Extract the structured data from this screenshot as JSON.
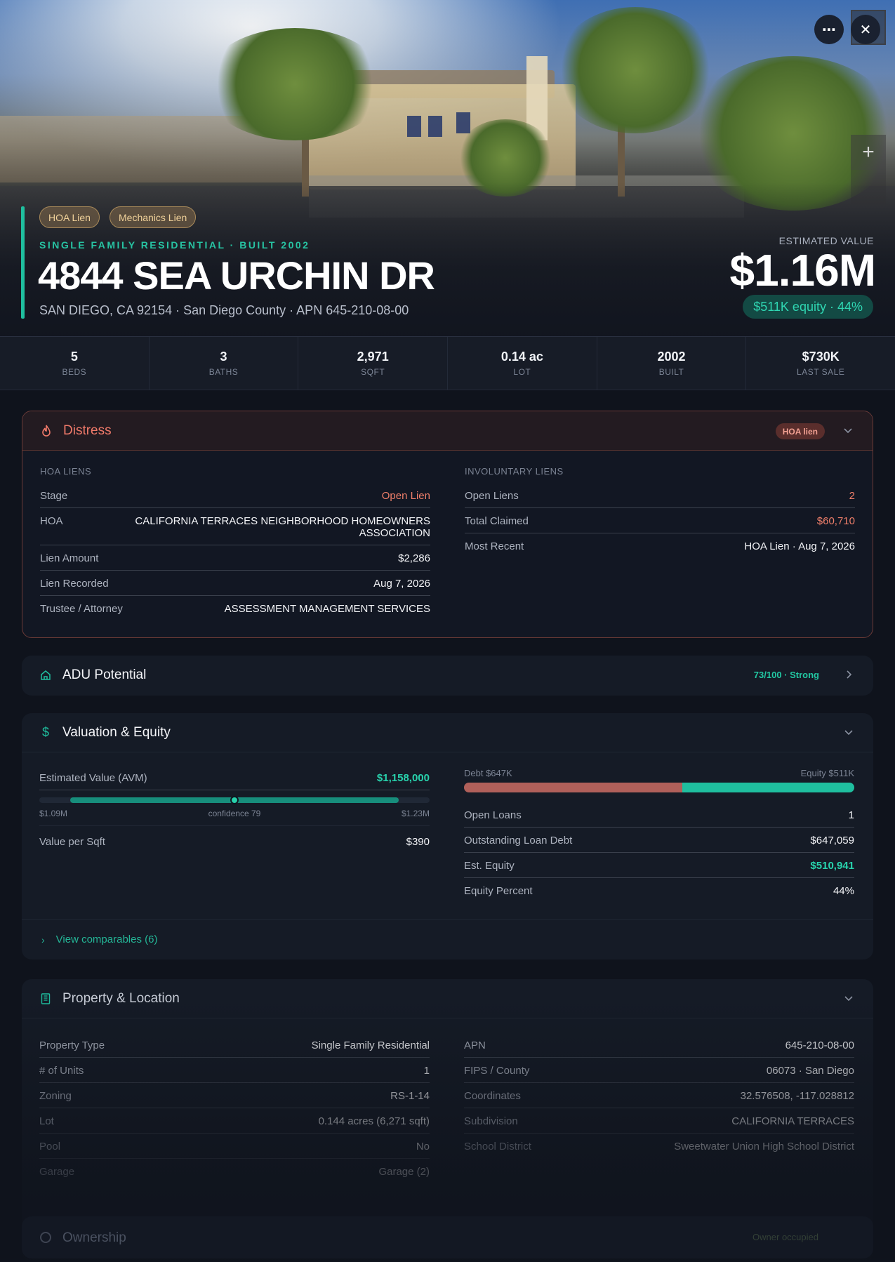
{
  "hero": {
    "chips": [
      "HOA Lien",
      "Mechanics Lien"
    ],
    "subtype": "SINGLE FAMILY RESIDENTIAL · BUILT 2002",
    "address": "4844 SEA URCHIN DR",
    "address_sub": "SAN DIEGO, CA 92154 · San Diego County · APN 645-210-08-00",
    "estimated_label": "ESTIMATED VALUE",
    "estimated_value": "$1.16M",
    "equity_pill": "$511K equity · 44%"
  },
  "stats": [
    {
      "value": "5",
      "label": "BEDS"
    },
    {
      "value": "3",
      "label": "BATHS"
    },
    {
      "value": "2,971",
      "label": "SQFT"
    },
    {
      "value": "0.14 ac",
      "label": "LOT"
    },
    {
      "value": "2002",
      "label": "BUILT"
    },
    {
      "value": "$730K",
      "label": "LAST SALE"
    }
  ],
  "distress": {
    "title": "Distress",
    "badge": "HOA lien",
    "hoa_label": "HOA LIENS",
    "hoa_rows": [
      {
        "label": "Stage",
        "value": "Open Lien"
      },
      {
        "label": "HOA",
        "value": "CALIFORNIA TERRACES NEIGHBORHOOD HOMEOWNERS ASSOCIATION"
      },
      {
        "label": "Lien Amount",
        "value": "$2,286"
      },
      {
        "label": "Lien Recorded",
        "value": "Aug 7, 2026"
      },
      {
        "label": "Trustee / Attorney",
        "value": "ASSESSMENT MANAGEMENT SERVICES"
      }
    ],
    "invol_label": "INVOLUNTARY LIENS",
    "invol_rows": [
      {
        "label": "Open Liens",
        "value": "2"
      },
      {
        "label": "Total Claimed",
        "value": "$60,710"
      },
      {
        "label": "Most Recent",
        "value": "HOA Lien · Aug 7, 2026"
      }
    ]
  },
  "adu": {
    "title": "ADU Potential",
    "score": "73/100 · Strong"
  },
  "valuation": {
    "title": "Valuation & Equity",
    "avm_label": "Estimated Value (AVM)",
    "avm_value": "$1,158,000",
    "range_low": "$1.09M",
    "range_mid": "confidence 79",
    "range_high": "$1.23M",
    "range_position": 0.5,
    "value_per_sqft_label": "Value per Sqft",
    "value_per_sqft": "$390",
    "debt_label": "Debt $647K",
    "equity_label": "Equity $511K",
    "debt_fraction": 0.56,
    "rows": [
      {
        "label": "Open Loans",
        "value": "1"
      },
      {
        "label": "Outstanding Loan Debt",
        "value": "$647,059"
      },
      {
        "label": "Est. Equity",
        "value": "$510,941"
      },
      {
        "label": "Equity Percent",
        "value": "44%"
      }
    ],
    "comps_link": "View comparables (6)"
  },
  "property": {
    "title": "Property & Location",
    "left_rows": [
      {
        "label": "Property Type",
        "value": "Single Family Residential"
      },
      {
        "label": "# of Units",
        "value": "1"
      },
      {
        "label": "Zoning",
        "value": "RS-1-14"
      },
      {
        "label": "Lot",
        "value": "0.144 acres (6,271 sqft)"
      },
      {
        "label": "Pool",
        "value": "No"
      },
      {
        "label": "Garage",
        "value": "Garage (2)"
      }
    ],
    "right_rows": [
      {
        "label": "APN",
        "value": "645-210-08-00"
      },
      {
        "label": "FIPS / County",
        "value": "06073 · San Diego"
      },
      {
        "label": "Coordinates",
        "value": "32.576508, -117.028812"
      },
      {
        "label": "Subdivision",
        "value": "CALIFORNIA TERRACES"
      },
      {
        "label": "School District",
        "value": "Sweetwater Union High School District"
      }
    ]
  },
  "ownership": {
    "title": "Ownership",
    "tag": "Owner occupied"
  },
  "colors": {
    "accent": "#1fbf9f",
    "danger": "#ef7f6a",
    "debt": "#b0605a"
  }
}
